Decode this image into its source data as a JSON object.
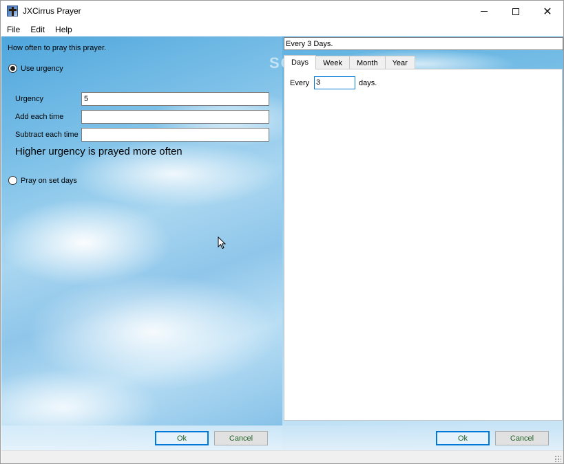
{
  "window": {
    "title": "JXCirrus Prayer",
    "minimize_glyph": "",
    "close_glyph": "✕"
  },
  "menu": {
    "items": [
      "File",
      "Edit",
      "Help"
    ]
  },
  "left": {
    "question": "How often to pray this prayer.",
    "use_urgency_label": "Use urgency",
    "urgency_label": "Urgency",
    "urgency_value": "5",
    "add_each_time_label": "Add each time",
    "add_each_time_value": "",
    "subtract_each_time_label": "Subtract each time",
    "subtract_each_time_value": "",
    "hint": "Higher urgency is prayed more often",
    "set_days_label": "Pray on set days",
    "ok_label": "Ok",
    "cancel_label": "Cancel"
  },
  "right": {
    "summary": "Every 3 Days.",
    "tabs": [
      "Days",
      "Week",
      "Month",
      "Year"
    ],
    "active_tab": "Days",
    "every_label": "Every",
    "every_value": "3",
    "days_label": "days.",
    "ok_label": "Ok",
    "cancel_label": "Cancel"
  },
  "watermark": "SOFTPEDIA",
  "colors": {
    "accent": "#0078d7",
    "button_text": "#1b5e20",
    "sky": "#7cc0e8"
  }
}
